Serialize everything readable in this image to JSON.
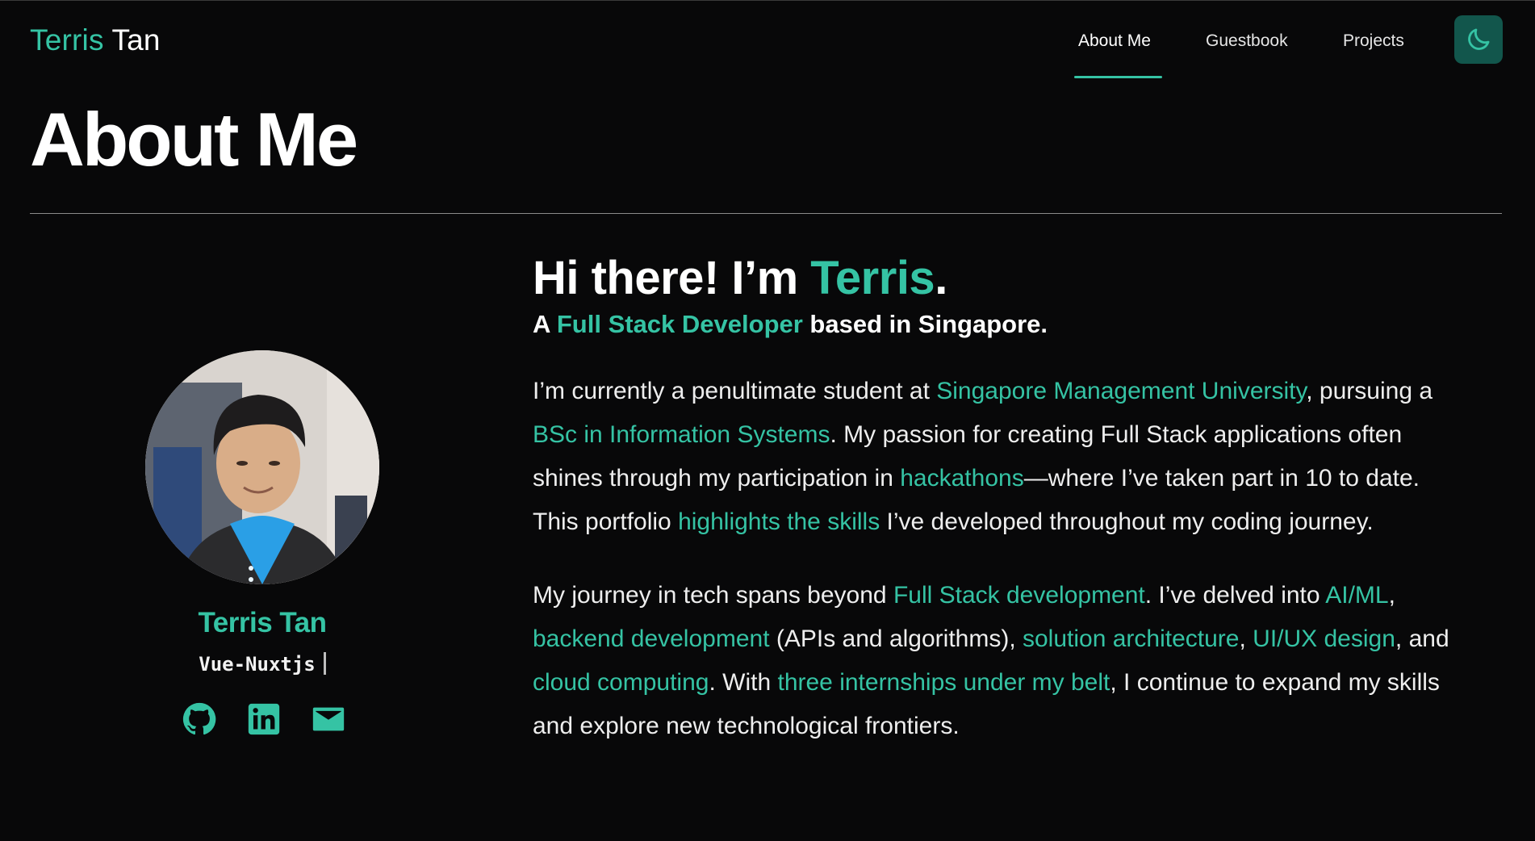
{
  "brand": {
    "first": "Terris",
    "last": "Tan"
  },
  "nav": {
    "items": [
      {
        "label": "About Me",
        "active": true
      },
      {
        "label": "Guestbook",
        "active": false
      },
      {
        "label": "Projects",
        "active": false
      }
    ],
    "theme_toggle_icon": "moon-icon"
  },
  "page_title": "About Me",
  "profile": {
    "name": "Terris Tan",
    "typed_text": "Vue-Nuxtjs",
    "socials": [
      {
        "icon": "github-icon"
      },
      {
        "icon": "linkedin-icon"
      },
      {
        "icon": "mail-icon"
      }
    ]
  },
  "intro": {
    "greeting_prefix": "Hi there! I’m ",
    "greeting_name": "Terris",
    "greeting_suffix": ".",
    "subtitle_prefix": "A ",
    "subtitle_role": "Full Stack Developer",
    "subtitle_suffix": " based in Singapore."
  },
  "para1": {
    "t1": "I’m currently a penultimate student at ",
    "l1": "Singapore Management University",
    "t2": ", pursuing a ",
    "l2": "BSc in Information Systems",
    "t3": ". My passion for creating Full Stack applications often shines through my participation in ",
    "l3": "hackathons",
    "t4": "—where I’ve taken part in 10 to date. This portfolio ",
    "l4": "highlights the skills",
    "t5": " I’ve developed throughout my coding journey."
  },
  "para2": {
    "t1": "My journey in tech spans beyond ",
    "l1": "Full Stack development",
    "t2": ". I’ve delved into ",
    "l2": "AI/ML",
    "t3": ", ",
    "l3": "backend development",
    "t4": " (APIs and algorithms), ",
    "l4": "solution architecture",
    "t5": ", ",
    "l5": "UI/UX design",
    "t6": ", and ",
    "l6": "cloud computing",
    "t7": ". With ",
    "l7": "three internships under my belt",
    "t8": ", I continue to expand my skills and explore new technological frontiers."
  },
  "colors": {
    "accent": "#35c3a4",
    "background": "#080809",
    "toggle_bg": "#12564c"
  }
}
